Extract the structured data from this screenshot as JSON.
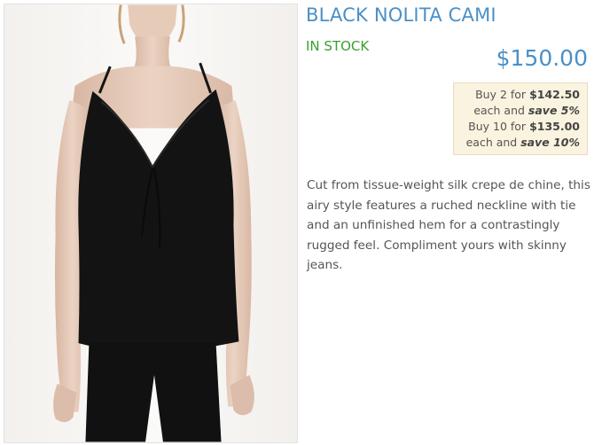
{
  "product": {
    "title": "BLACK NOLITA CAMI",
    "stock_status": "IN STOCK",
    "price": "$150.00",
    "image_alt": "Model wearing black silk cami",
    "description": "Cut from tissue-weight silk crepe de chine, this airy style features a ruched neckline with tie and an unfinished hem for a contrastingly rugged feel. Compliment yours with skinny jeans."
  },
  "discounts": [
    {
      "prefix": "Buy 2 for ",
      "price": "$142.50",
      "each": "each and ",
      "save": "save 5%"
    },
    {
      "prefix": "Buy 10 for ",
      "price": "$135.00",
      "each": "each and ",
      "save": "save 10%"
    }
  ],
  "colors": {
    "title": "#4a90c8",
    "price": "#4a90c8",
    "stock": "#3aa02f",
    "discount_bg": "#faf3df"
  }
}
